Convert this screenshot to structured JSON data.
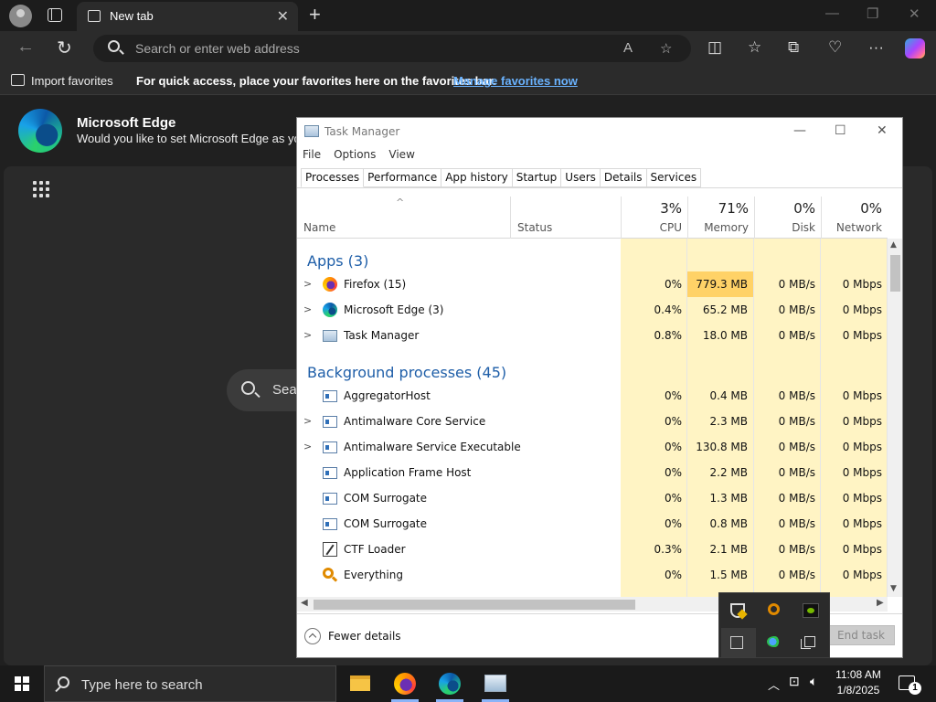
{
  "browser": {
    "tab_title": "New tab",
    "address_placeholder": "Search or enter web address",
    "favorites": {
      "import_label": "Import favorites",
      "message": "For quick access, place your favorites here on the favorites bar.",
      "manage_link": "Manage favorites now"
    },
    "banner": {
      "title": "Microsoft Edge",
      "subtitle": "Would you like to set Microsoft Edge as your"
    },
    "page_search_text": "Sea"
  },
  "taskmgr": {
    "title": "Task Manager",
    "menu": [
      "File",
      "Options",
      "View"
    ],
    "tabs": [
      "Processes",
      "Performance",
      "App history",
      "Startup",
      "Users",
      "Details",
      "Services"
    ],
    "active_tab": "Processes",
    "columns": {
      "name": "Name",
      "status": "Status",
      "cpu": {
        "pct": "3%",
        "label": "CPU"
      },
      "memory": {
        "pct": "71%",
        "label": "Memory"
      },
      "disk": {
        "pct": "0%",
        "label": "Disk"
      },
      "network": {
        "pct": "0%",
        "label": "Network"
      }
    },
    "groups": {
      "apps": "Apps (3)",
      "background": "Background processes (45)"
    },
    "apps": [
      {
        "name": "Firefox (15)",
        "icon": "firefox-icon",
        "expandable": true,
        "cpu": "0%",
        "memory": "779.3 MB",
        "disk": "0 MB/s",
        "network": "0 Mbps"
      },
      {
        "name": "Microsoft Edge (3)",
        "icon": "edge-icon",
        "expandable": true,
        "cpu": "0.4%",
        "memory": "65.2 MB",
        "disk": "0 MB/s",
        "network": "0 Mbps"
      },
      {
        "name": "Task Manager",
        "icon": "task-manager-icon",
        "expandable": true,
        "cpu": "0.8%",
        "memory": "18.0 MB",
        "disk": "0 MB/s",
        "network": "0 Mbps"
      }
    ],
    "background": [
      {
        "name": "AggregatorHost",
        "icon": "service-icon",
        "expandable": false,
        "cpu": "0%",
        "memory": "0.4 MB",
        "disk": "0 MB/s",
        "network": "0 Mbps"
      },
      {
        "name": "Antimalware Core Service",
        "icon": "service-icon",
        "expandable": true,
        "cpu": "0%",
        "memory": "2.3 MB",
        "disk": "0 MB/s",
        "network": "0 Mbps"
      },
      {
        "name": "Antimalware Service Executable",
        "icon": "service-icon",
        "expandable": true,
        "cpu": "0%",
        "memory": "130.8 MB",
        "disk": "0 MB/s",
        "network": "0 Mbps"
      },
      {
        "name": "Application Frame Host",
        "icon": "service-icon",
        "expandable": false,
        "cpu": "0%",
        "memory": "2.2 MB",
        "disk": "0 MB/s",
        "network": "0 Mbps"
      },
      {
        "name": "COM Surrogate",
        "icon": "service-icon",
        "expandable": false,
        "cpu": "0%",
        "memory": "1.3 MB",
        "disk": "0 MB/s",
        "network": "0 Mbps"
      },
      {
        "name": "COM Surrogate",
        "icon": "service-icon",
        "expandable": false,
        "cpu": "0%",
        "memory": "0.8 MB",
        "disk": "0 MB/s",
        "network": "0 Mbps"
      },
      {
        "name": "CTF Loader",
        "icon": "ctf-loader-icon",
        "expandable": false,
        "cpu": "0.3%",
        "memory": "2.1 MB",
        "disk": "0 MB/s",
        "network": "0 Mbps"
      },
      {
        "name": "Everything",
        "icon": "everything-search-icon",
        "expandable": false,
        "cpu": "0%",
        "memory": "1.5 MB",
        "disk": "0 MB/s",
        "network": "0 Mbps"
      }
    ],
    "fewer_details": "Fewer details",
    "end_task": "End task"
  },
  "taskbar": {
    "search_placeholder": "Type here to search",
    "time": "11:08 AM",
    "date": "1/8/2025",
    "notification_count": "1"
  },
  "colors": {
    "memory_hot": "#ffd267",
    "heat_light": "#fff4c4",
    "group_blue": "#1e5ea8",
    "link_blue": "#6ab3ff"
  }
}
